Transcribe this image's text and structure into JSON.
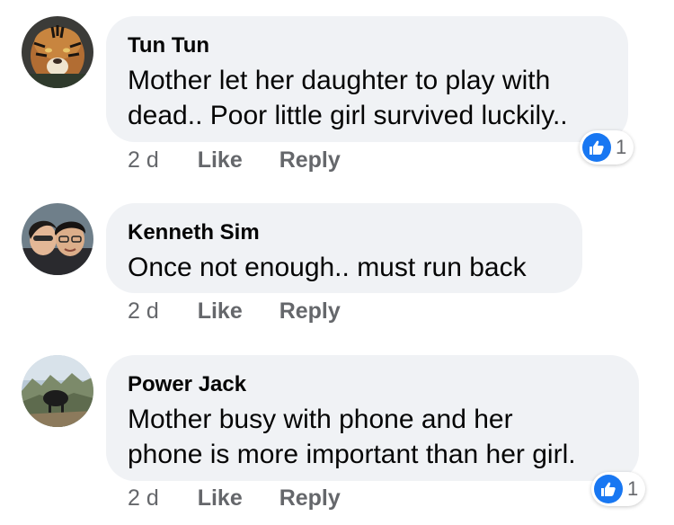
{
  "colors": {
    "bubble_background": "#f0f2f5",
    "meta_text": "#65676b",
    "like_reaction_blue": "#1877f2"
  },
  "comments": [
    {
      "author": "Tun Tun",
      "text_lines": [
        "Mother let her daughter to play with",
        "dead.. Poor little girl survived luckily.."
      ],
      "time": "2 d",
      "like_label": "Like",
      "reply_label": "Reply",
      "reaction": {
        "icon": "thumbs-up-icon",
        "count": "1"
      },
      "avatar_icon": "tiger-avatar"
    },
    {
      "author": "Kenneth Sim",
      "text_lines": [
        "Once not enough.. must run back"
      ],
      "time": "2 d",
      "like_label": "Like",
      "reply_label": "Reply",
      "avatar_icon": "couple-avatar"
    },
    {
      "author": "Power Jack",
      "text_lines": [
        "Mother busy with phone and her",
        "phone is more important than her girl."
      ],
      "time": "2 d",
      "like_label": "Like",
      "reply_label": "Reply",
      "reaction": {
        "icon": "thumbs-up-icon",
        "count": "1"
      },
      "avatar_icon": "landscape-avatar"
    }
  ]
}
